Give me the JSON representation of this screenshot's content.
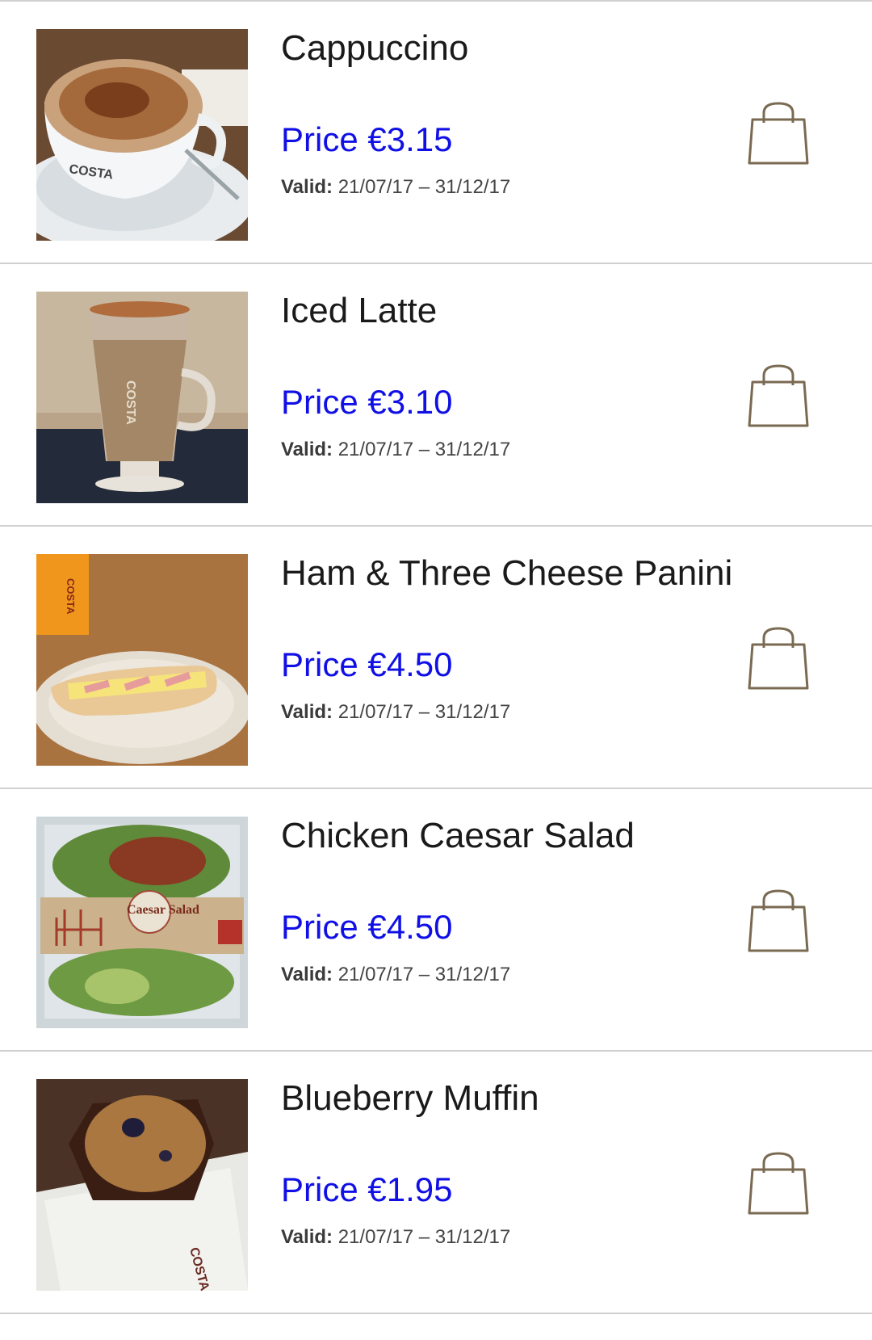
{
  "colors": {
    "price": "#1010e6",
    "title": "#1a1a1a",
    "bag_icon": "#7a6a52",
    "divider": "#d0d0d0"
  },
  "products": [
    {
      "name": "Cappuccino",
      "price": "Price €3.15",
      "valid_label": "Valid:",
      "valid_range": " 21/07/17 – 31/12/17",
      "image": "cappuccino-photo",
      "image_text": "COSTA",
      "bag_icon": "shopping-bag-icon"
    },
    {
      "name": "Iced Latte",
      "price": "Price €3.10",
      "valid_label": "Valid:",
      "valid_range": " 21/07/17 – 31/12/17",
      "image": "iced-latte-photo",
      "image_text": "COSTA",
      "bag_icon": "shopping-bag-icon"
    },
    {
      "name": "Ham & Three Cheese Panini",
      "price": "Price €4.50",
      "valid_label": "Valid:",
      "valid_range": " 21/07/17 – 31/12/17",
      "image": "panini-photo",
      "image_text": "COSTA",
      "bag_icon": "shopping-bag-icon"
    },
    {
      "name": "Chicken Caesar Salad",
      "price": "Price €4.50",
      "valid_label": "Valid:",
      "valid_range": " 21/07/17 – 31/12/17",
      "image": "caesar-salad-photo",
      "image_text": "Caesar Salad",
      "bag_icon": "shopping-bag-icon"
    },
    {
      "name": "Blueberry Muffin",
      "price": "Price €1.95",
      "valid_label": "Valid:",
      "valid_range": " 21/07/17 – 31/12/17",
      "image": "blueberry-muffin-photo",
      "image_text": "COSTA",
      "bag_icon": "shopping-bag-icon"
    }
  ]
}
